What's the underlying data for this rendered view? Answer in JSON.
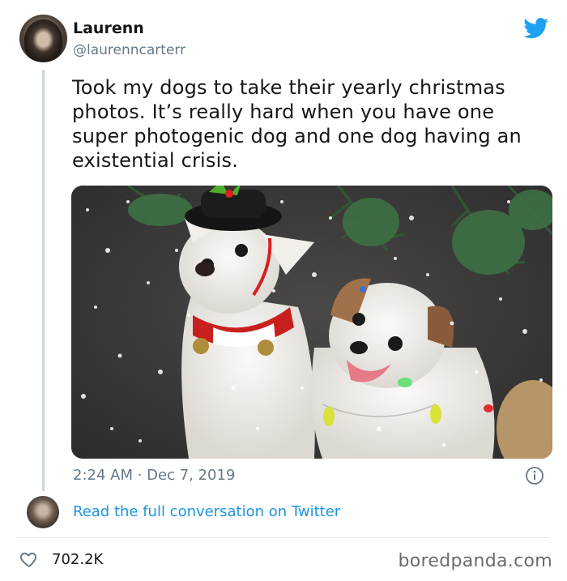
{
  "author": {
    "name": "Laurenn",
    "handle": "@laurenncarterr"
  },
  "icons": {
    "brand": "twitter-bird-icon",
    "info": "info-icon",
    "like": "heart-icon",
    "brand_color": "#1da1f2"
  },
  "tweet": {
    "text": "Took my dogs to take their yearly christmas photos. It’s really hard when you have one super photogenic dog and one dog having an existential crisis.",
    "timestamp": "2:24 AM · Dec 7, 2019",
    "likes": "702.2K"
  },
  "conversation": {
    "link_text": "Read the full conversation on Twitter",
    "link_color": "#1b95e0"
  },
  "watermark": "boredpanda.com"
}
